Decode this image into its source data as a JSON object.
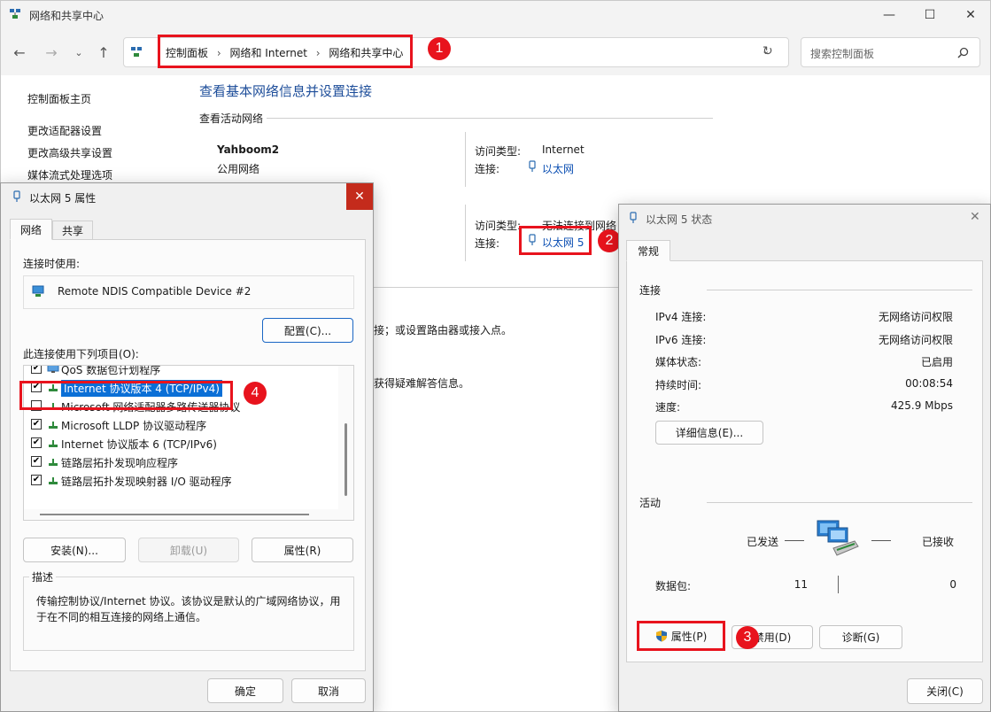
{
  "main": {
    "title": "网络和共享中心",
    "breadcrumb": [
      "控制面板",
      "网络和 Internet",
      "网络和共享中心"
    ],
    "search_placeholder": "搜索控制面板",
    "sidebar": [
      "控制面板主页",
      "更改适配器设置",
      "更改高级共享设置",
      "媒体流式处理选项"
    ],
    "heading": "查看基本网络信息并设置连接",
    "active_networks_label": "查看活动网络",
    "network1": {
      "name": "Yahboom2",
      "category": "公用网络",
      "access_label": "访问类型:",
      "access_value": "Internet",
      "conn_label": "连接:",
      "conn_value": "以太网"
    },
    "network2": {
      "access_label": "访问类型:",
      "access_value": "无法连接到网络",
      "conn_label": "连接:",
      "conn_value": "以太网 5"
    },
    "text_frag1": "接；或设置路由器或接入点。",
    "text_frag2": "获得疑难解答信息。"
  },
  "annotations": [
    "1",
    "2",
    "3",
    "4"
  ],
  "accent_red": "#e8131d",
  "props": {
    "title": "以太网 5 属性",
    "tabs": [
      "网络",
      "共享"
    ],
    "connect_using_label": "连接时使用:",
    "device": "Remote NDIS Compatible Device #2",
    "configure_btn": "配置(C)...",
    "items_label": "此连接使用下列项目(O):",
    "items": [
      {
        "label": "QoS 数据包计划程序",
        "checked": true,
        "icon": "qos-icon"
      },
      {
        "label": "Internet 协议版本 4 (TCP/IPv4)",
        "checked": true,
        "icon": "protocol-icon"
      },
      {
        "label": "Microsoft 网络适配器多路传送器协议",
        "checked": false,
        "icon": "protocol-icon"
      },
      {
        "label": "Microsoft LLDP 协议驱动程序",
        "checked": true,
        "icon": "protocol-icon"
      },
      {
        "label": "Internet 协议版本 6 (TCP/IPv6)",
        "checked": true,
        "icon": "protocol-icon"
      },
      {
        "label": "链路层拓扑发现响应程序",
        "checked": true,
        "icon": "protocol-icon"
      },
      {
        "label": "链路层拓扑发现映射器 I/O 驱动程序",
        "checked": true,
        "icon": "protocol-icon"
      }
    ],
    "install_btn": "安装(N)...",
    "uninstall_btn": "卸载(U)",
    "properties_btn": "属性(R)",
    "desc_label": "描述",
    "desc_text": "传输控制协议/Internet 协议。该协议是默认的广域网络协议，用于在不同的相互连接的网络上通信。",
    "ok_btn": "确定",
    "cancel_btn": "取消"
  },
  "status": {
    "title": "以太网 5 状态",
    "tab": "常规",
    "conn_section": "连接",
    "rows": [
      {
        "label": "IPv4 连接:",
        "value": "无网络访问权限"
      },
      {
        "label": "IPv6 连接:",
        "value": "无网络访问权限"
      },
      {
        "label": "媒体状态:",
        "value": "已启用"
      },
      {
        "label": "持续时间:",
        "value": "00:08:54"
      },
      {
        "label": "速度:",
        "value": "425.9 Mbps"
      }
    ],
    "details_btn": "详细信息(E)...",
    "activity_section": "活动",
    "sent_label": "已发送",
    "received_label": "已接收",
    "packets_label": "数据包:",
    "packets_sent": "11",
    "packets_received": "0",
    "properties_btn": "属性(P)",
    "disable_btn": "禁用(D)",
    "diagnose_btn": "诊断(G)",
    "close_btn": "关闭(C)"
  }
}
